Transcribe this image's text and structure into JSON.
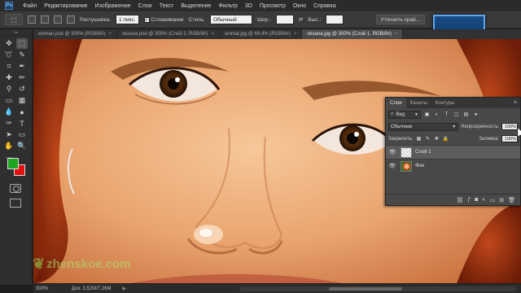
{
  "menubar": {
    "logo": "Ps",
    "items": [
      "Файл",
      "Редактирование",
      "Изображение",
      "Слои",
      "Текст",
      "Выделение",
      "Фильтр",
      "3D",
      "Просмотр",
      "Окно",
      "Справка"
    ]
  },
  "options": {
    "feather_label": "Растушевка:",
    "feather_value": "1 пикс.",
    "antialias_label": "Сглаживание",
    "style_label": "Стиль:",
    "style_value": "Обычный",
    "width_label": "Шир.:",
    "height_label": "Выс.:",
    "refine_button": "Уточнить край..."
  },
  "tabs": [
    {
      "label": "woman.psd @ 300% (RGB/8#)"
    },
    {
      "label": "oksana.psd @ 300% (Слой 2, RGB/8#)"
    },
    {
      "label": "animal.jpg @ 69,4% (RGB/8#)"
    },
    {
      "label": "oksana.jpg @ 300% (Слой 1, RGB/8#)"
    }
  ],
  "layers_panel": {
    "tabs": [
      "Слои",
      "Каналы",
      "Контуры"
    ],
    "kind_label": "Вид",
    "blend_mode": "Обычные",
    "opacity_label": "Непрозрачность:",
    "opacity_value": "100%",
    "lock_label": "Закрепить:",
    "fill_label": "Заливка:",
    "fill_value": "100%",
    "layers": [
      {
        "name": "Слой 1",
        "selected": true
      },
      {
        "name": "Фон",
        "selected": false
      }
    ]
  },
  "status": {
    "zoom": "300%",
    "doc": "Док: 3,52М/7,26М"
  },
  "watermark": "zhenskoe.com",
  "colors": {
    "foreground": "#1fa51f",
    "background": "#e01010"
  }
}
